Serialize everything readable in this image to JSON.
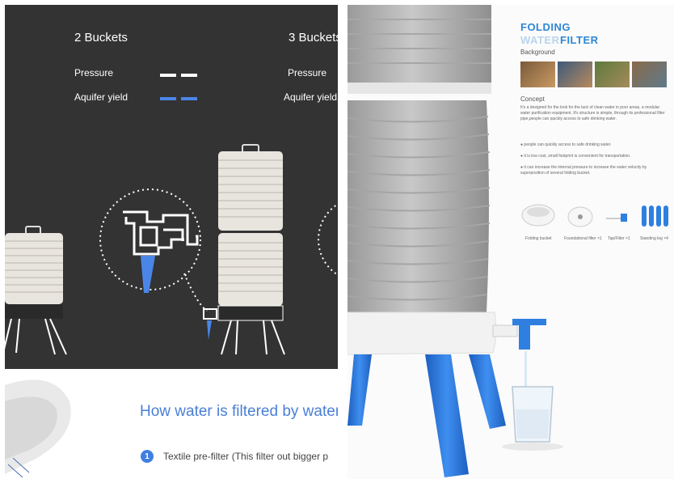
{
  "left": {
    "header_2": "2 Buckets",
    "header_3": "3 Buckets",
    "pressure_1": "Pressure",
    "aquifer_1": "Aquifer yield",
    "pressure_2": "Pressure",
    "aquifer_2": "Aquifer yield",
    "how_title": "How water is filtered by water",
    "step1_number": "1",
    "step1_text": "Textile pre-filter (This filter out bigger p",
    "colors": {
      "dark_bg": "#333333",
      "aquifer": "#4a86e8",
      "title": "#4a7fd6"
    }
  },
  "right": {
    "title_line1": "FOLDING",
    "title_water": "WATER",
    "title_filter": "FILTER",
    "background_label": "Background",
    "concept_label": "Concept",
    "concept_text": "It's a designed for the look for the lack of clean water in poor areas, a modular water purification equipment. It's structure is simple, through its professional filter pipe,people can quickly access to safe drinking water.",
    "bullets": [
      "people can quickly access to safe drinking water.",
      "it is low cost, small footprint is convenient for transportation.",
      "it can increase the internal pressure to increase the water velocity by superposition of several folding bucket."
    ],
    "parts": [
      "Folding bucket",
      "Foundational filter ×1",
      "Tap/Filter ×1",
      "Standing leg ×4"
    ],
    "colors": {
      "accent": "#2f86d3",
      "legs": "#2f7fe0"
    }
  }
}
